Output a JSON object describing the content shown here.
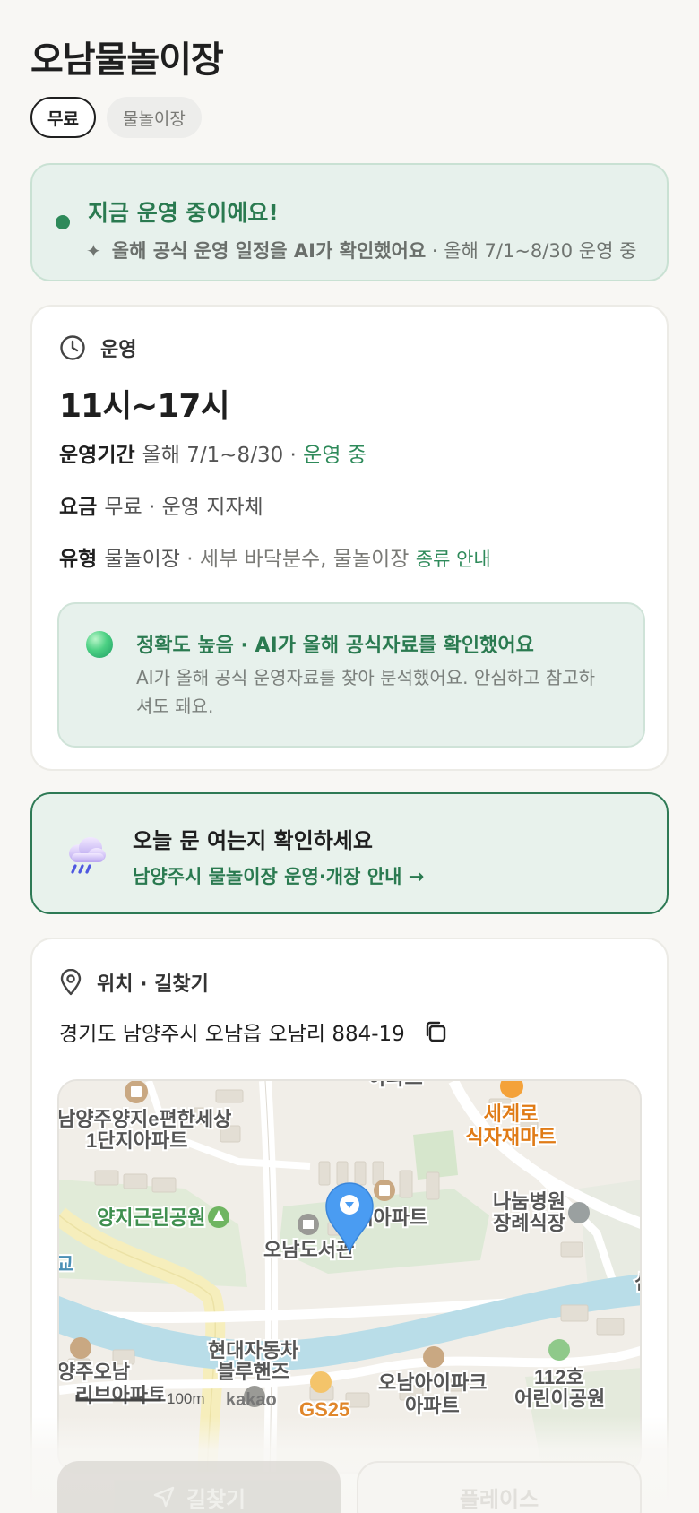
{
  "place": {
    "title": "오남물놀이장",
    "tags": [
      "무료",
      "물놀이장"
    ]
  },
  "status": {
    "title": "지금 운영 중이에요!",
    "ai_note": "올해 공식 운영 일정을 AI가 확인했어요",
    "schedule_note": "· 올해 7/1~8/30 운영 중"
  },
  "hours": {
    "section_label": "운영",
    "time_range": "11시~17시",
    "period_label": "운영기간",
    "period_value": "올해 7/1~8/30 ·",
    "period_status": "운영 중",
    "fee_label": "요금",
    "fee_value": "무료 · 운영 지자체",
    "type_label": "유형",
    "type_value": "물놀이장",
    "type_detail": "· 세부 바닥분수, 물놀이장",
    "type_link": "종류 안내"
  },
  "accuracy": {
    "title": "정확도 높음 · AI가 올해 공식자료를 확인했어요",
    "description": "AI가 올해 공식 운영자료를 찾아 분석했어요. 안심하고 참고하셔도 돼요."
  },
  "notice": {
    "title": "오늘 문 여는지 확인하세요",
    "link": "남양주시 물놀이장 운영·개장 안내 →"
  },
  "location": {
    "section_label": "위치 · 길찾기",
    "address": "경기도 남양주시 오남읍 오남리 884-19"
  },
  "map": {
    "labels": {
      "apt_top": "아파트",
      "mart_1": "세계로",
      "mart_2": "식자재마트",
      "apt_left_1": "남양주양지e편한세상",
      "apt_left_2": "1단지아파트",
      "park": "양지근린공원",
      "apt_center": "현대아파트",
      "library": "오남도서관",
      "hospital_1": "나눔병원",
      "hospital_2": "장례식장",
      "left_edge": "교",
      "right_edge": "심",
      "car_1": "현대자동차",
      "car_2": "블루핸즈",
      "apt_bl_1": "양주오남",
      "apt_bl_2": "리브아파트",
      "ipark_1": "오남아이파크",
      "ipark_2": "아파트",
      "kinder_1": "112호",
      "kinder_2": "어린이공원",
      "gs": "GS25",
      "scale": "100m",
      "brand": "kakao"
    }
  },
  "actions": {
    "directions": "길찾기",
    "place": "플레이스"
  },
  "colors": {
    "accent_green": "#2e8a5a",
    "status_bg": "#e7f1ec",
    "notice_border": "#2e7a55",
    "map_water": "#b9dde8",
    "map_pin": "#4a9cf2"
  }
}
